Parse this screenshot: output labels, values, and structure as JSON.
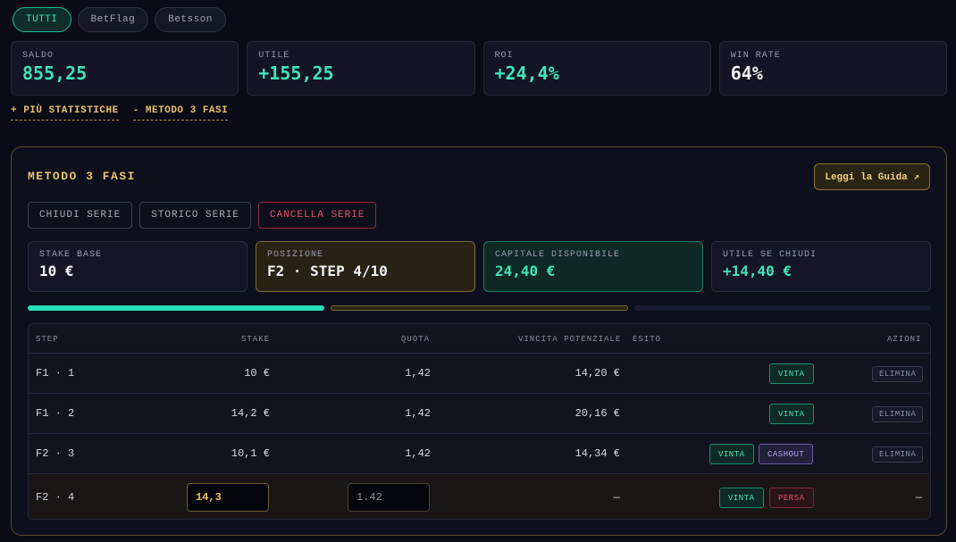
{
  "filters": [
    {
      "label": "TUTTI",
      "active": true
    },
    {
      "label": "BetFlag",
      "active": false
    },
    {
      "label": "Betsson",
      "active": false
    }
  ],
  "stats": [
    {
      "label": "SALDO",
      "value": "855,25",
      "color": "teal"
    },
    {
      "label": "UTILE",
      "value": "+155,25",
      "color": "teal"
    },
    {
      "label": "ROI",
      "value": "+24,4%",
      "color": "teal"
    },
    {
      "label": "WIN RATE",
      "value": "64%",
      "color": "white"
    }
  ],
  "links": {
    "more_stats": "+ PIÙ STATISTICHE",
    "method": "- METODO 3 FASI"
  },
  "panel": {
    "title": "METODO 3 FASI",
    "guide_label": "Leggi la Guida ↗",
    "actions": {
      "close": "CHIUDI SERIE",
      "history": "STORICO SERIE",
      "delete": "CANCELLA SERIE"
    },
    "cards": [
      {
        "label": "STAKE BASE",
        "value": "10 €"
      },
      {
        "label": "POSIZIONE",
        "value": "F2 · STEP 4/10"
      },
      {
        "label": "CAPITALE DISPONIBILE",
        "value": "24,40 €"
      },
      {
        "label": "UTILE SE CHIUDI",
        "value": "+14,40 €"
      }
    ],
    "progress": {
      "phases": 3,
      "completed": 1,
      "current": 2
    }
  },
  "table": {
    "headers": {
      "step": "STEP",
      "stake": "STAKE",
      "quota": "QUOTA",
      "vincita": "VINCITA POTENZIALE",
      "esito": "ESITO",
      "azioni": "AZIONI"
    },
    "rows": [
      {
        "step": "F1 · 1",
        "stake": "10 €",
        "quota": "1,42",
        "vincita": "14,20 €",
        "win": "VINTA",
        "del": "ELIMINA"
      },
      {
        "step": "F1 · 2",
        "stake": "14,2 €",
        "quota": "1,42",
        "vincita": "20,16 €",
        "win": "VINTA",
        "del": "ELIMINA"
      },
      {
        "step": "F2 · 3",
        "stake": "10,1 €",
        "quota": "1,42",
        "vincita": "14,34 €",
        "win": "VINTA",
        "cash": "CASHOUT",
        "del": "ELIMINA"
      }
    ],
    "active_row": {
      "step": "F2 · 4",
      "stake_value": "14,3",
      "quota_placeholder": "1.42",
      "vincita": "—",
      "win": "VINTA",
      "lose": "PERSA",
      "azioni": "—"
    }
  },
  "colors": {
    "teal": "#3ee6b8",
    "gold": "#e8c46a",
    "danger": "#e0506a",
    "bg": "#0a0b16"
  }
}
